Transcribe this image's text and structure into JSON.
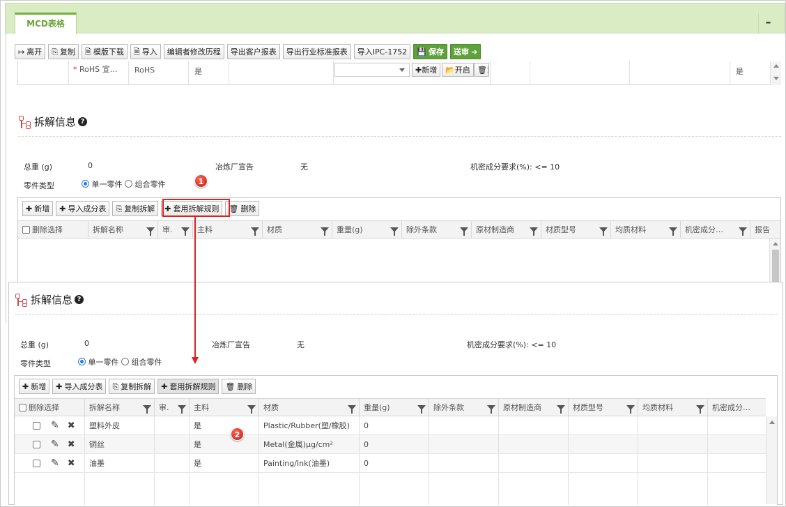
{
  "tab": {
    "title": "MCD表格",
    "minimize": "–"
  },
  "toolbar": [
    {
      "icon": "↦",
      "label": "离开"
    },
    {
      "icon": "⎘",
      "label": "复制"
    },
    {
      "icon": "🗎",
      "label": "模版下载"
    },
    {
      "icon": "🗎",
      "label": "导入"
    },
    {
      "icon": "",
      "label": "编辑者修改历程"
    },
    {
      "icon": "",
      "label": "导出客户报表"
    },
    {
      "icon": "",
      "label": "导出行业标准报表"
    },
    {
      "icon": "",
      "label": "导入IPC-1752"
    },
    {
      "icon": "💾",
      "label": "保存"
    },
    {
      "icon": "➜",
      "label": "送审"
    }
  ],
  "rohs_row": {
    "required_mark": "*",
    "name": "RoHS 宣…",
    "type": "RoHS",
    "value": "是",
    "add": "✚新增",
    "open": "📂开启",
    "del": "🗑重",
    "last": "是"
  },
  "section": {
    "title": "拆解信息",
    "help": "?"
  },
  "info": {
    "total_weight_label": "总重 (g)",
    "total_weight_value": "0",
    "smelter_label": "冶炼厂宣告",
    "smelter_value": "无",
    "confidential_label": "机密成分要求(%):",
    "confidential_value": "<= 10",
    "part_type_label": "零件类型",
    "single": "单一零件",
    "combo": "组合零件"
  },
  "grid_buttons": {
    "add": "新增",
    "import": "导入成分表",
    "copy": "复制拆解",
    "apply": "套用拆解规则",
    "delete": "删除"
  },
  "columns_top": [
    "删除选择",
    "拆解名称",
    "审.",
    "主料",
    "材质",
    "重量(g)",
    "除外条款",
    "原材制造商",
    "材质型号",
    "均质材料",
    "机密成分…",
    "报告"
  ],
  "columns_bottom": [
    "删除选择",
    "拆解名称",
    "审.",
    "主料",
    "材质",
    "重量(g)",
    "除外条款",
    "原材制造商",
    "材质型号",
    "均质材料",
    "机密成分…"
  ],
  "rows": [
    {
      "name": "塑料外皮",
      "main": "是",
      "material": "Plastic/Rubber(塑/橡胶)",
      "weight": "0"
    },
    {
      "name": "铜丝",
      "main": "是",
      "material": "Metal(金属)μg/cm²",
      "weight": "0"
    },
    {
      "name": "油墨",
      "main": "是",
      "material": "Painting/Ink(油墨)",
      "weight": "0"
    }
  ],
  "callouts": {
    "one": "1",
    "two": "2"
  },
  "icons": {
    "pencil": "✎",
    "cross": "✖"
  }
}
